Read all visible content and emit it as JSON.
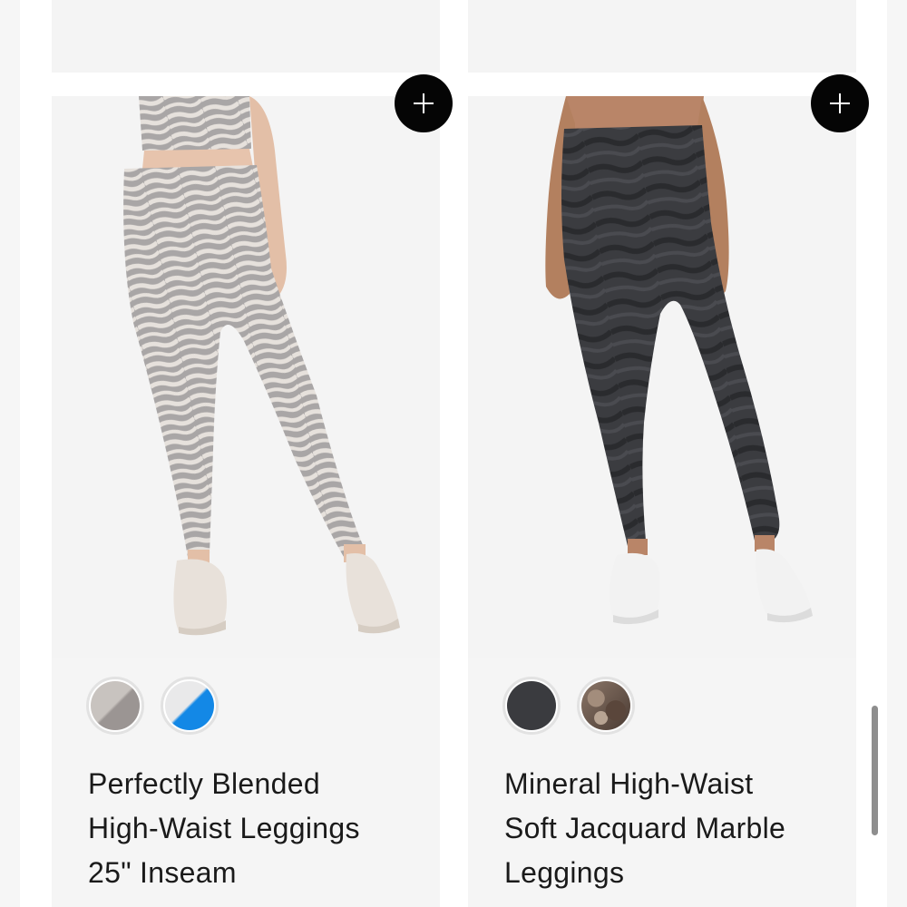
{
  "products": [
    {
      "title_lines": [
        "Perfectly Blended",
        "High-Waist Leggings",
        "25\" Inseam"
      ],
      "add_button": "+",
      "swatches": [
        {
          "name": "Grey Zebra",
          "colors": [
            "#c8c3bf",
            "#9b9593"
          ]
        },
        {
          "name": "White/Blue",
          "colors": [
            "#e9e9ea",
            "#1388e6"
          ]
        }
      ]
    },
    {
      "title_lines": [
        "Mineral High-Waist",
        "Soft Jacquard Marble",
        "Leggings"
      ],
      "add_button": "+",
      "swatches": [
        {
          "name": "Charcoal",
          "colors": [
            "#3a3b3f"
          ]
        },
        {
          "name": "Marble Brown",
          "colors": [
            "#8b7668",
            "#4a3b33"
          ]
        }
      ]
    }
  ],
  "colors": {
    "card_bg": "#f5f5f5",
    "button_bg": "#050505",
    "text": "#1a1a1a"
  },
  "icons": {
    "add": "plus-icon"
  }
}
